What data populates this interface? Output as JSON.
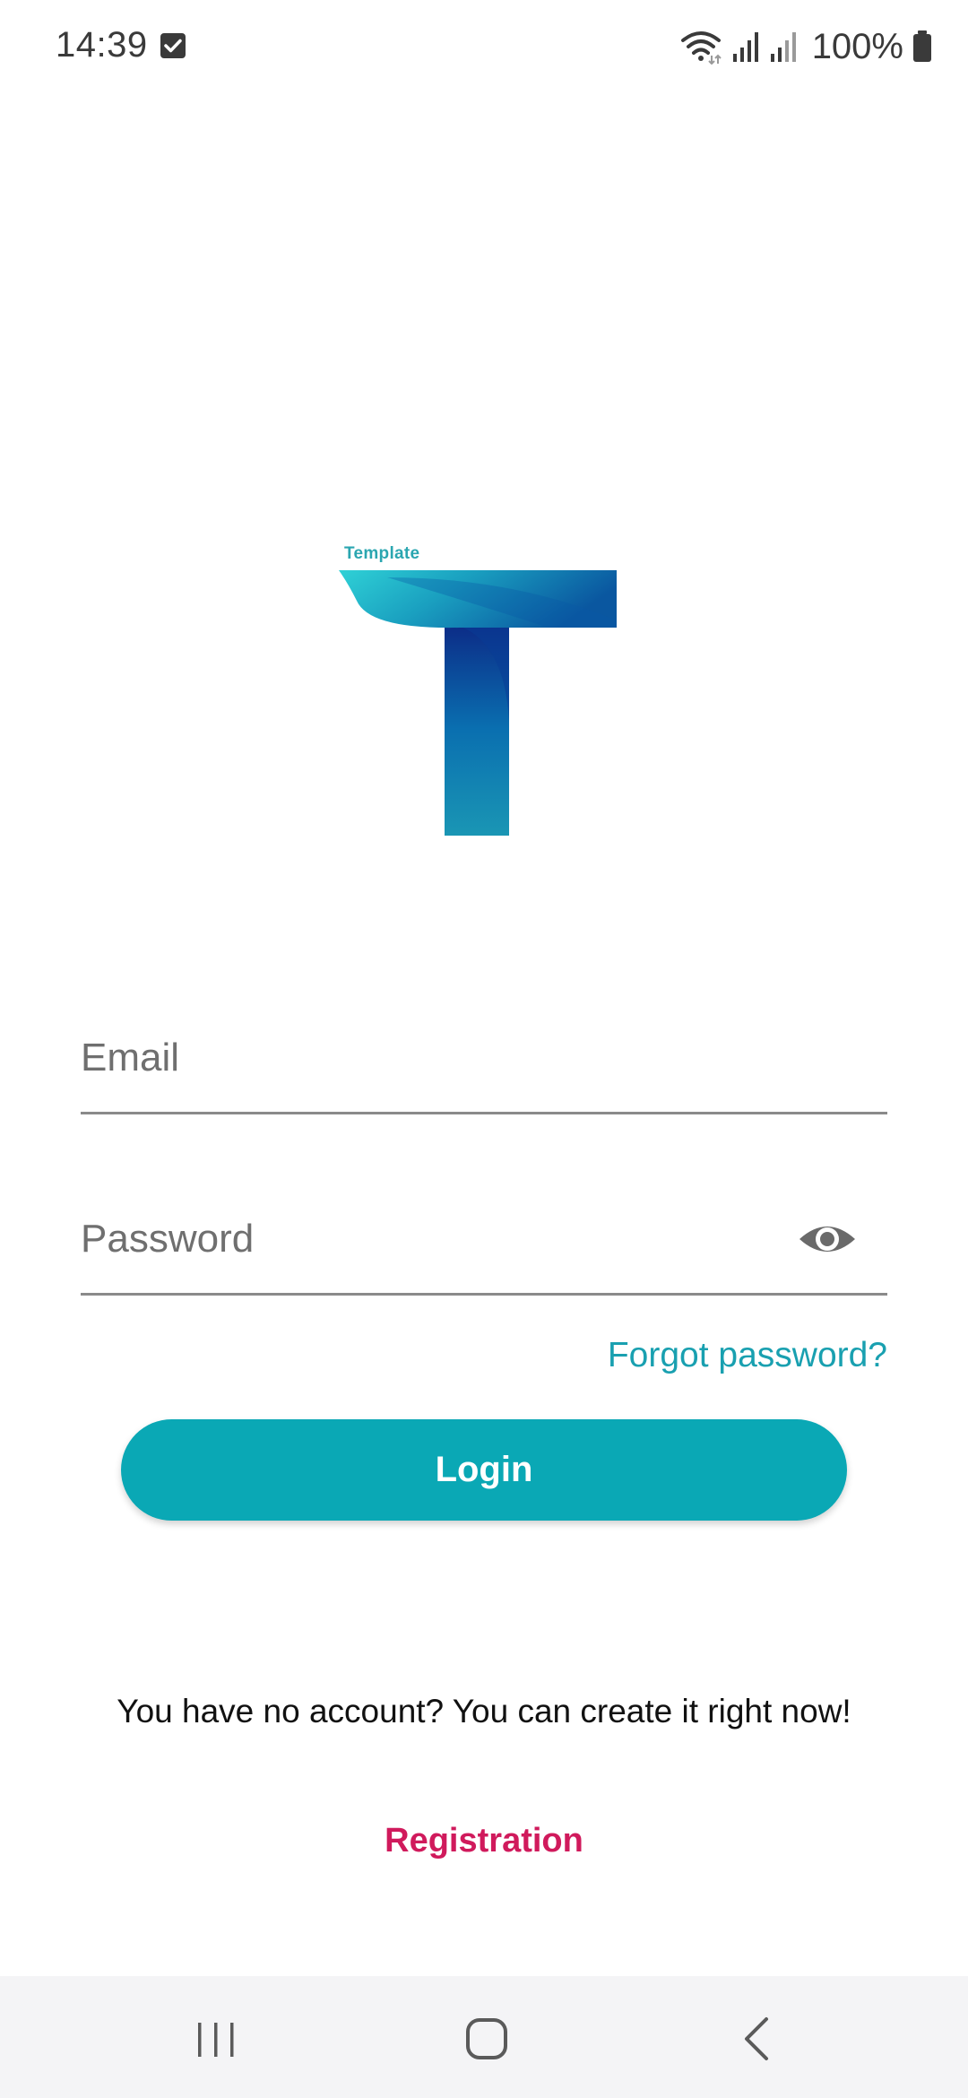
{
  "status_bar": {
    "time": "14:39",
    "battery_percent": "100%",
    "icons": [
      "checkbox-notification-icon",
      "wifi-icon",
      "signal-icon",
      "signal-icon",
      "battery-icon"
    ]
  },
  "logo": {
    "caption": "Template",
    "letter": "T"
  },
  "form": {
    "email_placeholder": "Email",
    "password_placeholder": "Password",
    "email_value": "",
    "password_value": ""
  },
  "forgot_password_label": "Forgot password?",
  "login_button_label": "Login",
  "no_account_text": "You have no account? You can create it right now!",
  "registration_label": "Registration",
  "colors": {
    "accent": "#0aa8b5",
    "link": "#19a0b0",
    "registration": "#d01a5c"
  },
  "nav_bar": {
    "buttons": [
      "recents-icon",
      "home-icon",
      "back-icon"
    ]
  }
}
